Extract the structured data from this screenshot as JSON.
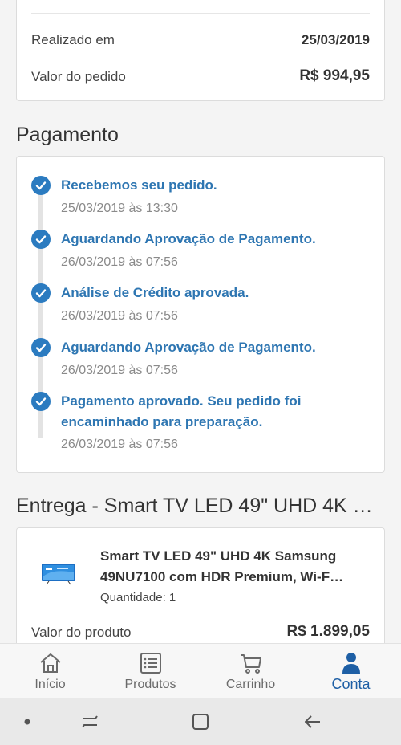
{
  "order": {
    "date_label": "Realizado em",
    "date_value": "25/03/2019",
    "total_label": "Valor do pedido",
    "total_value": "R$ 994,95"
  },
  "payment": {
    "title": "Pagamento",
    "steps": [
      {
        "title": "Recebemos seu pedido.",
        "time": "25/03/2019 às 13:30"
      },
      {
        "title": "Aguardando Aprovação de Pagamento.",
        "time": "26/03/2019 às 07:56"
      },
      {
        "title": "Análise de Crédito aprovada.",
        "time": "26/03/2019 às 07:56"
      },
      {
        "title": "Aguardando Aprovação de Pagamento.",
        "time": "26/03/2019 às 07:56"
      },
      {
        "title": "Pagamento aprovado. Seu pedido foi encaminhado para preparação.",
        "time": "26/03/2019 às 07:56"
      }
    ]
  },
  "delivery": {
    "title": "Entrega - Smart TV LED 49\" UHD 4K …",
    "product_name_line1": "Smart TV LED 49\" UHD 4K Samsung",
    "product_name_line2": "49NU7100 com HDR Premium, Wi-F…",
    "quantity": "Quantidade: 1",
    "price_label": "Valor do produto",
    "price_value": "R$ 1.899,05"
  },
  "nav": {
    "items": [
      {
        "label": "Início",
        "icon": "home-icon"
      },
      {
        "label": "Produtos",
        "icon": "list-icon"
      },
      {
        "label": "Carrinho",
        "icon": "cart-icon"
      },
      {
        "label": "Conta",
        "icon": "user-icon"
      }
    ],
    "active_index": 3
  },
  "colors": {
    "accent": "#2b7bc0",
    "link_text": "#2e76b2",
    "nav_active": "#1e5fa5"
  }
}
